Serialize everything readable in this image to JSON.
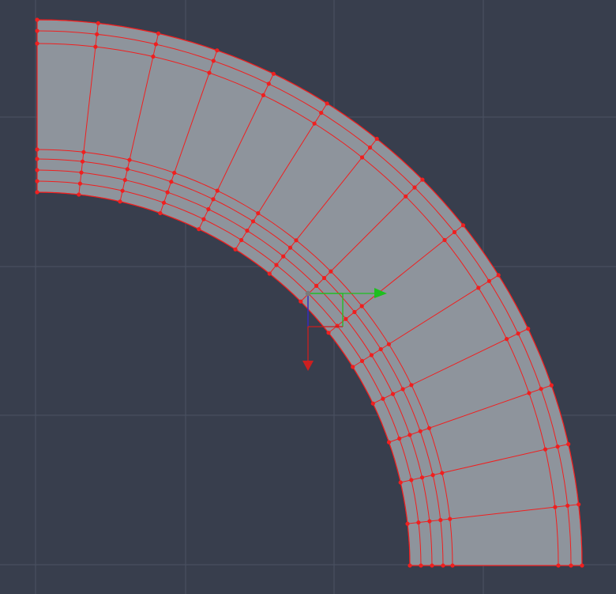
{
  "viewport": {
    "background": "#383e4d",
    "grid_color": "#4b5262",
    "mesh_fill": "#8e949c",
    "edge_color": "#f01f1f",
    "vertex_color": "#f01f1f",
    "gizmo": {
      "x_axis_color": "#1fbf1f",
      "y_axis_color": "#cc1f1f",
      "z_axis_color": "#1f2fd6",
      "origin_color": "#7a7a7a"
    }
  }
}
